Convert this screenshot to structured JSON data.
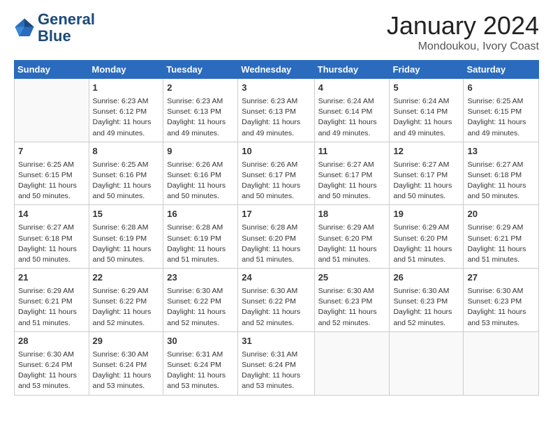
{
  "header": {
    "logo_line1": "General",
    "logo_line2": "Blue",
    "month_title": "January 2024",
    "location": "Mondoukou, Ivory Coast"
  },
  "weekdays": [
    "Sunday",
    "Monday",
    "Tuesday",
    "Wednesday",
    "Thursday",
    "Friday",
    "Saturday"
  ],
  "weeks": [
    [
      {
        "day": "",
        "sunrise": "",
        "sunset": "",
        "daylight": ""
      },
      {
        "day": "1",
        "sunrise": "Sunrise: 6:23 AM",
        "sunset": "Sunset: 6:12 PM",
        "daylight": "Daylight: 11 hours and 49 minutes."
      },
      {
        "day": "2",
        "sunrise": "Sunrise: 6:23 AM",
        "sunset": "Sunset: 6:13 PM",
        "daylight": "Daylight: 11 hours and 49 minutes."
      },
      {
        "day": "3",
        "sunrise": "Sunrise: 6:23 AM",
        "sunset": "Sunset: 6:13 PM",
        "daylight": "Daylight: 11 hours and 49 minutes."
      },
      {
        "day": "4",
        "sunrise": "Sunrise: 6:24 AM",
        "sunset": "Sunset: 6:14 PM",
        "daylight": "Daylight: 11 hours and 49 minutes."
      },
      {
        "day": "5",
        "sunrise": "Sunrise: 6:24 AM",
        "sunset": "Sunset: 6:14 PM",
        "daylight": "Daylight: 11 hours and 49 minutes."
      },
      {
        "day": "6",
        "sunrise": "Sunrise: 6:25 AM",
        "sunset": "Sunset: 6:15 PM",
        "daylight": "Daylight: 11 hours and 49 minutes."
      }
    ],
    [
      {
        "day": "7",
        "sunrise": "Sunrise: 6:25 AM",
        "sunset": "Sunset: 6:15 PM",
        "daylight": "Daylight: 11 hours and 50 minutes."
      },
      {
        "day": "8",
        "sunrise": "Sunrise: 6:25 AM",
        "sunset": "Sunset: 6:16 PM",
        "daylight": "Daylight: 11 hours and 50 minutes."
      },
      {
        "day": "9",
        "sunrise": "Sunrise: 6:26 AM",
        "sunset": "Sunset: 6:16 PM",
        "daylight": "Daylight: 11 hours and 50 minutes."
      },
      {
        "day": "10",
        "sunrise": "Sunrise: 6:26 AM",
        "sunset": "Sunset: 6:17 PM",
        "daylight": "Daylight: 11 hours and 50 minutes."
      },
      {
        "day": "11",
        "sunrise": "Sunrise: 6:27 AM",
        "sunset": "Sunset: 6:17 PM",
        "daylight": "Daylight: 11 hours and 50 minutes."
      },
      {
        "day": "12",
        "sunrise": "Sunrise: 6:27 AM",
        "sunset": "Sunset: 6:17 PM",
        "daylight": "Daylight: 11 hours and 50 minutes."
      },
      {
        "day": "13",
        "sunrise": "Sunrise: 6:27 AM",
        "sunset": "Sunset: 6:18 PM",
        "daylight": "Daylight: 11 hours and 50 minutes."
      }
    ],
    [
      {
        "day": "14",
        "sunrise": "Sunrise: 6:27 AM",
        "sunset": "Sunset: 6:18 PM",
        "daylight": "Daylight: 11 hours and 50 minutes."
      },
      {
        "day": "15",
        "sunrise": "Sunrise: 6:28 AM",
        "sunset": "Sunset: 6:19 PM",
        "daylight": "Daylight: 11 hours and 50 minutes."
      },
      {
        "day": "16",
        "sunrise": "Sunrise: 6:28 AM",
        "sunset": "Sunset: 6:19 PM",
        "daylight": "Daylight: 11 hours and 51 minutes."
      },
      {
        "day": "17",
        "sunrise": "Sunrise: 6:28 AM",
        "sunset": "Sunset: 6:20 PM",
        "daylight": "Daylight: 11 hours and 51 minutes."
      },
      {
        "day": "18",
        "sunrise": "Sunrise: 6:29 AM",
        "sunset": "Sunset: 6:20 PM",
        "daylight": "Daylight: 11 hours and 51 minutes."
      },
      {
        "day": "19",
        "sunrise": "Sunrise: 6:29 AM",
        "sunset": "Sunset: 6:20 PM",
        "daylight": "Daylight: 11 hours and 51 minutes."
      },
      {
        "day": "20",
        "sunrise": "Sunrise: 6:29 AM",
        "sunset": "Sunset: 6:21 PM",
        "daylight": "Daylight: 11 hours and 51 minutes."
      }
    ],
    [
      {
        "day": "21",
        "sunrise": "Sunrise: 6:29 AM",
        "sunset": "Sunset: 6:21 PM",
        "daylight": "Daylight: 11 hours and 51 minutes."
      },
      {
        "day": "22",
        "sunrise": "Sunrise: 6:29 AM",
        "sunset": "Sunset: 6:22 PM",
        "daylight": "Daylight: 11 hours and 52 minutes."
      },
      {
        "day": "23",
        "sunrise": "Sunrise: 6:30 AM",
        "sunset": "Sunset: 6:22 PM",
        "daylight": "Daylight: 11 hours and 52 minutes."
      },
      {
        "day": "24",
        "sunrise": "Sunrise: 6:30 AM",
        "sunset": "Sunset: 6:22 PM",
        "daylight": "Daylight: 11 hours and 52 minutes."
      },
      {
        "day": "25",
        "sunrise": "Sunrise: 6:30 AM",
        "sunset": "Sunset: 6:23 PM",
        "daylight": "Daylight: 11 hours and 52 minutes."
      },
      {
        "day": "26",
        "sunrise": "Sunrise: 6:30 AM",
        "sunset": "Sunset: 6:23 PM",
        "daylight": "Daylight: 11 hours and 52 minutes."
      },
      {
        "day": "27",
        "sunrise": "Sunrise: 6:30 AM",
        "sunset": "Sunset: 6:23 PM",
        "daylight": "Daylight: 11 hours and 53 minutes."
      }
    ],
    [
      {
        "day": "28",
        "sunrise": "Sunrise: 6:30 AM",
        "sunset": "Sunset: 6:24 PM",
        "daylight": "Daylight: 11 hours and 53 minutes."
      },
      {
        "day": "29",
        "sunrise": "Sunrise: 6:30 AM",
        "sunset": "Sunset: 6:24 PM",
        "daylight": "Daylight: 11 hours and 53 minutes."
      },
      {
        "day": "30",
        "sunrise": "Sunrise: 6:31 AM",
        "sunset": "Sunset: 6:24 PM",
        "daylight": "Daylight: 11 hours and 53 minutes."
      },
      {
        "day": "31",
        "sunrise": "Sunrise: 6:31 AM",
        "sunset": "Sunset: 6:24 PM",
        "daylight": "Daylight: 11 hours and 53 minutes."
      },
      {
        "day": "",
        "sunrise": "",
        "sunset": "",
        "daylight": ""
      },
      {
        "day": "",
        "sunrise": "",
        "sunset": "",
        "daylight": ""
      },
      {
        "day": "",
        "sunrise": "",
        "sunset": "",
        "daylight": ""
      }
    ]
  ]
}
